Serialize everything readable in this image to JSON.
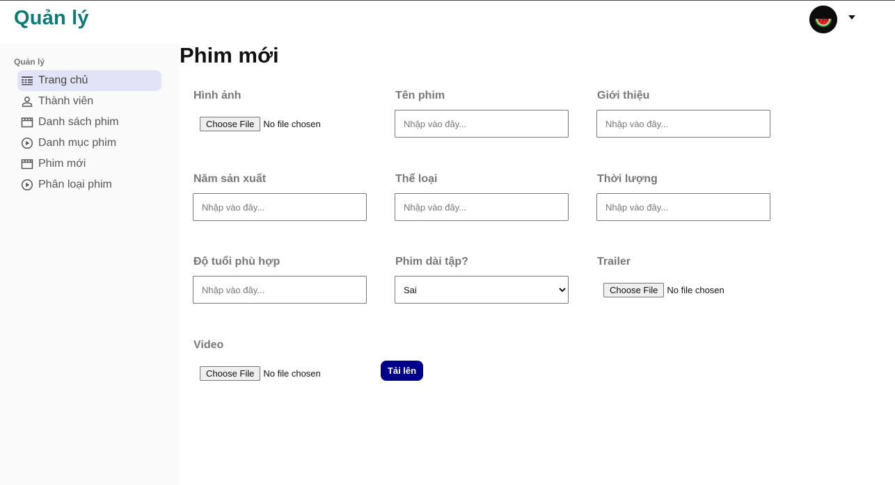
{
  "app": {
    "title": "Quản lý"
  },
  "sidebar": {
    "heading": "Quản lý",
    "items": [
      {
        "label": "Trang chủ",
        "icon": "dashboard-icon",
        "active": true
      },
      {
        "label": "Thành viên",
        "icon": "user-icon"
      },
      {
        "label": "Danh sách phim",
        "icon": "film-icon"
      },
      {
        "label": "Danh mục phim",
        "icon": "play-circle-icon"
      },
      {
        "label": "Phim mới",
        "icon": "film-icon"
      },
      {
        "label": "Phân loại phim",
        "icon": "play-circle-icon"
      }
    ]
  },
  "page": {
    "title": "Phim mới"
  },
  "form": {
    "image": {
      "label": "Hình ảnh",
      "button": "Choose File",
      "status": "No file chosen"
    },
    "name": {
      "label": "Tên phim",
      "placeholder": "Nhập vào đây..."
    },
    "intro": {
      "label": "Giới thiệu",
      "placeholder": "Nhập vào đây..."
    },
    "year": {
      "label": "Năm sản xuất",
      "placeholder": "Nhập vào đây..."
    },
    "genre": {
      "label": "Thể loại",
      "placeholder": "Nhập vào đây..."
    },
    "duration": {
      "label": "Thời lượng",
      "placeholder": "Nhập vào đây..."
    },
    "age": {
      "label": "Độ tuổi phù hợp",
      "placeholder": "Nhập vào đây..."
    },
    "series": {
      "label": "Phim dài tập?",
      "selected": "Sai"
    },
    "trailer": {
      "label": "Trailer",
      "button": "Choose File",
      "status": "No file chosen"
    },
    "video": {
      "label": "Video",
      "button": "Choose File",
      "status": "No file chosen"
    },
    "submit_label": "Tải lên"
  },
  "colors": {
    "brand": "#0d7a78",
    "submit": "#00008b",
    "active_item": "#e3e3f7"
  }
}
